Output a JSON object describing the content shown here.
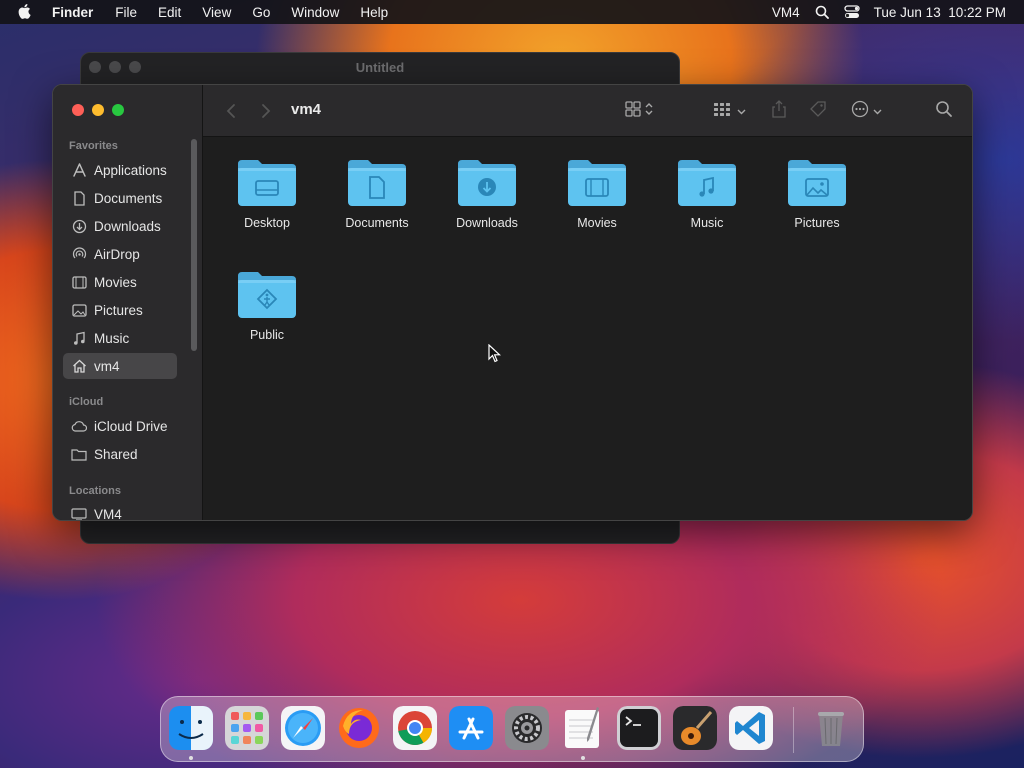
{
  "menubar": {
    "app_name": "Finder",
    "items": [
      "File",
      "Edit",
      "View",
      "Go",
      "Window",
      "Help"
    ],
    "user": "VM4",
    "datetime": "Tue Jun 13  10:22 PM"
  },
  "background_window": {
    "title": "Untitled"
  },
  "finder": {
    "path_title": "vm4",
    "sidebar": {
      "favorites_header": "Favorites",
      "favorites": [
        {
          "label": "Applications",
          "icon": "applications-icon"
        },
        {
          "label": "Documents",
          "icon": "document-icon"
        },
        {
          "label": "Downloads",
          "icon": "download-icon"
        },
        {
          "label": "AirDrop",
          "icon": "airdrop-icon"
        },
        {
          "label": "Movies",
          "icon": "film-icon"
        },
        {
          "label": "Pictures",
          "icon": "photo-icon"
        },
        {
          "label": "Music",
          "icon": "music-icon"
        },
        {
          "label": "vm4",
          "icon": "home-icon",
          "selected": true
        }
      ],
      "icloud_header": "iCloud",
      "icloud": [
        {
          "label": "iCloud Drive",
          "icon": "cloud-icon"
        },
        {
          "label": "Shared",
          "icon": "shared-folder-icon"
        }
      ],
      "locations_header": "Locations",
      "locations": [
        {
          "label": "VM4",
          "icon": "computer-icon"
        }
      ]
    },
    "folders": [
      {
        "label": "Desktop",
        "icon": "desktop-glyph"
      },
      {
        "label": "Documents",
        "icon": "document-glyph"
      },
      {
        "label": "Downloads",
        "icon": "download-glyph"
      },
      {
        "label": "Movies",
        "icon": "film-glyph"
      },
      {
        "label": "Music",
        "icon": "music-glyph"
      },
      {
        "label": "Pictures",
        "icon": "photo-glyph"
      },
      {
        "label": "Public",
        "icon": "public-glyph"
      }
    ]
  },
  "dock": {
    "apps": [
      "Finder",
      "Launchpad",
      "Safari",
      "Firefox",
      "Chrome",
      "App Store",
      "System Settings",
      "TextEdit",
      "Terminal",
      "GarageBand",
      "Visual Studio Code",
      "Trash"
    ]
  },
  "colors": {
    "folder_blue": "#5ec3f0",
    "selection": "#474648",
    "close": "#fe5f57",
    "minimize": "#febc2e",
    "maximize": "#28c840"
  }
}
